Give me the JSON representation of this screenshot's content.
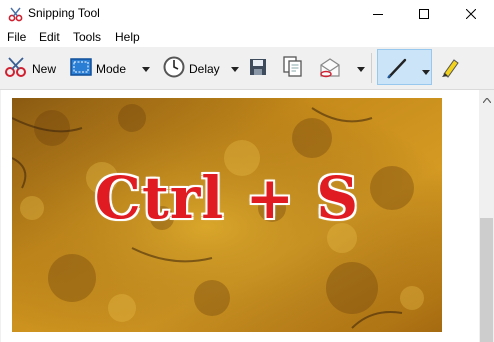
{
  "window": {
    "title": "Snipping Tool",
    "icon": "snipping-scissors-icon",
    "controls": {
      "minimize": "minimize-icon",
      "maximize": "maximize-icon",
      "close": "close-icon"
    }
  },
  "menu": {
    "items": [
      "File",
      "Edit",
      "Tools",
      "Help"
    ]
  },
  "toolbar": {
    "new_label": "New",
    "mode_label": "Mode",
    "delay_label": "Delay",
    "icons": [
      "scissors-icon",
      "rectangle-mode-icon",
      "clock-icon",
      "save-icon",
      "copy-icon",
      "send-email-icon",
      "pen-icon",
      "highlighter-icon"
    ]
  },
  "content": {
    "snip_text": "Ctrl + S"
  },
  "colors": {
    "snip_text": "#e11b22",
    "pen_selected_bg": "#cce4f7",
    "toolbar_bg": "#f0f0f0"
  }
}
